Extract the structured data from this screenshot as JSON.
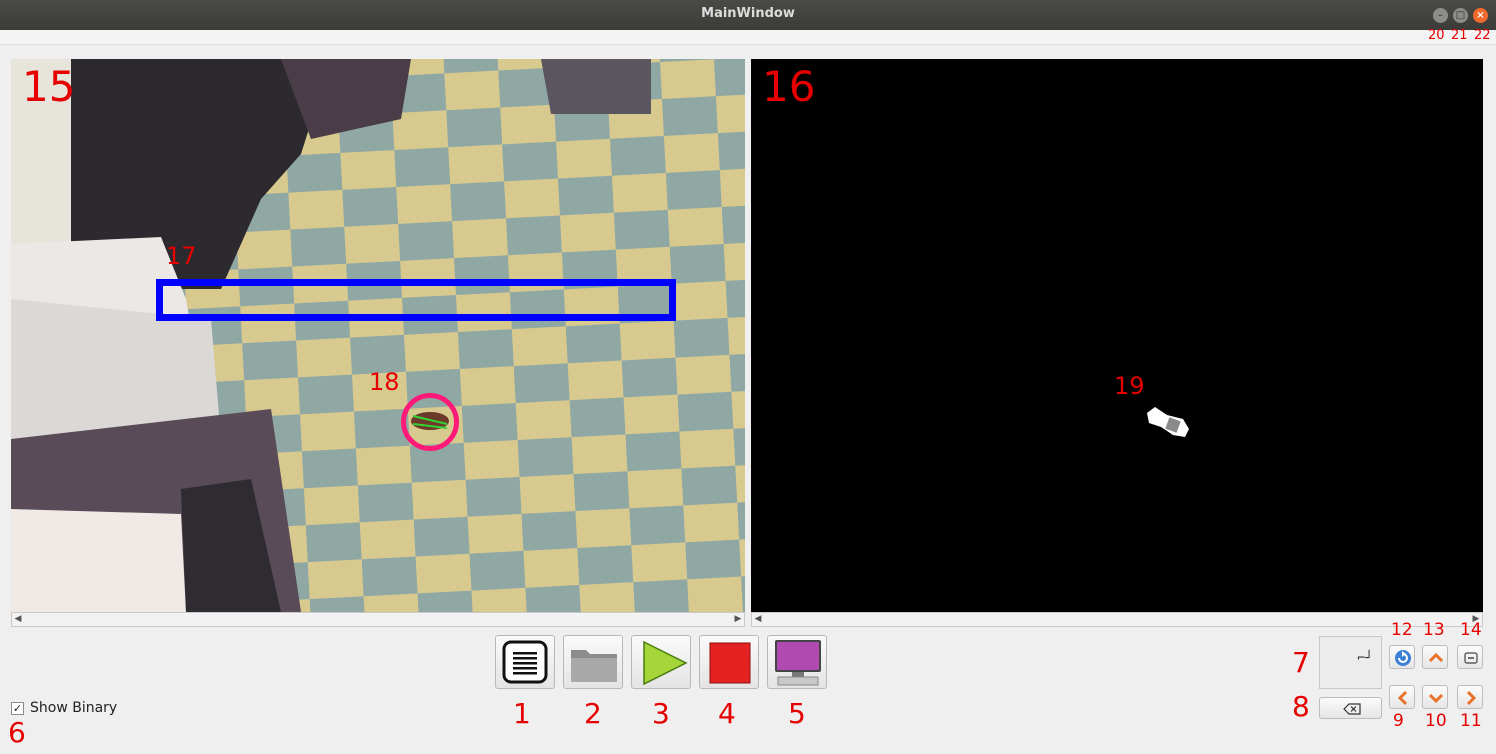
{
  "window": {
    "title": "MainWindow"
  },
  "labels": {
    "l1": "1",
    "l2": "2",
    "l3": "3",
    "l4": "4",
    "l5": "5",
    "l6": "6",
    "l7": "7",
    "l8": "8",
    "l9": "9",
    "l10": "10",
    "l11": "11",
    "l12": "12",
    "l13": "13",
    "l14": "14",
    "l15": "15",
    "l16": "16",
    "l17": "17",
    "l18": "18",
    "l19": "19",
    "l20": "20",
    "l21": "21",
    "l22": "22"
  },
  "controls": {
    "show_binary_label": "Show Binary",
    "show_binary_checked": "✓",
    "display_text": "⌐┘"
  },
  "toolbar": {
    "icons": [
      "menu-icon",
      "folder-icon",
      "play-icon",
      "stop-icon",
      "monitor-icon"
    ]
  },
  "colors": {
    "roi": "#0000ff",
    "detection": "#ff1a7a",
    "annotation": "#e60000",
    "accent_arrow": "#e8722a"
  }
}
